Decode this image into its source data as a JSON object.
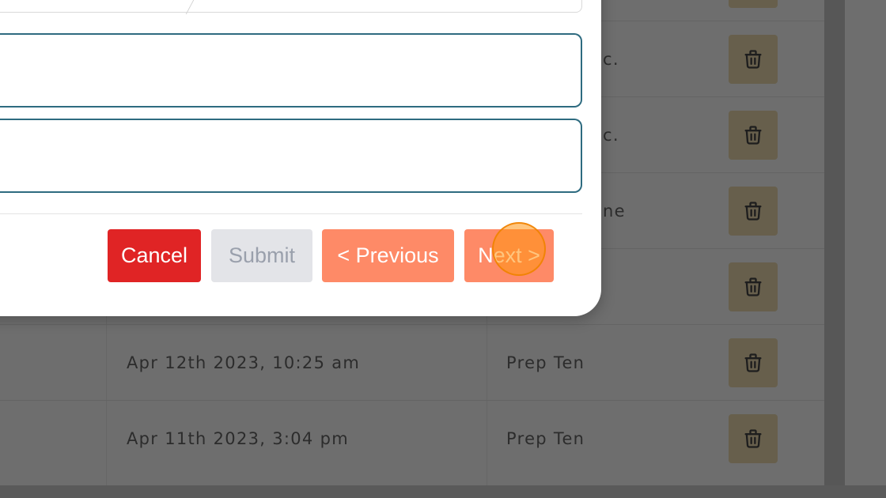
{
  "modal": {
    "buttons": {
      "cancel": "Cancel",
      "submit": "Submit",
      "previous": "< Previous",
      "next": "Next >"
    }
  },
  "table": {
    "rows": [
      {
        "date": "",
        "name": "",
        "partial": ""
      },
      {
        "date": "",
        "name": "",
        "partial": "c."
      },
      {
        "date": "",
        "name": "",
        "partial": "c."
      },
      {
        "date": "",
        "name": "",
        "partial": "ne"
      },
      {
        "date": "",
        "name": "",
        "partial": ""
      },
      {
        "date": "Apr 12th 2023, 10:25 am",
        "name": "Prep Ten",
        "partial": ""
      },
      {
        "date": "Apr 11th 2023, 3:04 pm",
        "name": "Prep Ten",
        "partial": ""
      }
    ]
  },
  "icons": {
    "delete": "trash-icon"
  }
}
